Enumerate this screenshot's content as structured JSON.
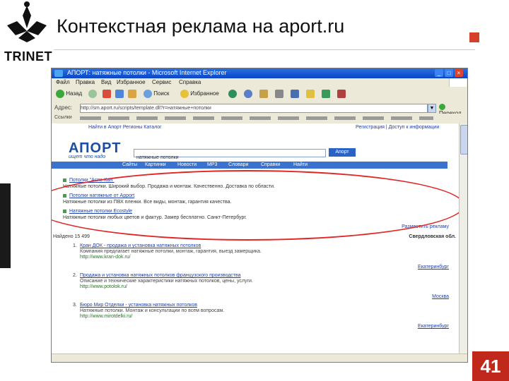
{
  "slide": {
    "title": "Контекстная реклама на aport.ru",
    "logo_text": "TRINET",
    "page_number": "41"
  },
  "browser": {
    "title": "АПОРТ: натяжные потолки - Microsoft Internet Explorer",
    "menu": [
      "Файл",
      "Правка",
      "Вид",
      "Избранное",
      "Сервис",
      "Справка"
    ],
    "toolbar": {
      "back": "Назад",
      "search": "Поиск",
      "favorites": "Избранное"
    },
    "address_label": "Адрес:",
    "address_value": "http://sm.aport.ru/scripts/template.dll?r=натяжные+потолки",
    "go_label": "Переход",
    "links": [
      "Ссылки"
    ],
    "status": ""
  },
  "aport": {
    "top_links": "Найти в Апорт   Регионы   Каталог",
    "right_links": "Регистрация | Доступ к информации",
    "logo": "АПОРТ",
    "slogan": "ищет что надо",
    "query": "натяжные потолки",
    "search_button": "Апорт",
    "tabs": [
      "Сайты",
      "Картинки",
      "Новости",
      "MP3",
      "Словари",
      "Справки",
      "Найти"
    ],
    "ads": [
      {
        "title": "Потолки \"Аспе-Кан\"",
        "text": "Натяжные потолки. Широкий выбор. Продажа и монтаж. Качественно. Доставка по области."
      },
      {
        "title": "Потолки натяжные от Apport",
        "text": "Натяжные потолки из ПВХ пленки. Все виды, монтаж, гарантия качества."
      },
      {
        "title": "Натяжные потолки Ecostyle",
        "text": "Натяжные потолки любых цветов и фактур. Замер бесплатно. Санкт-Петербург."
      }
    ],
    "ads_footer": "Разместить рекламу",
    "results_count": "Найдено 15 499",
    "results_region": "Свердловская обл.",
    "results": [
      {
        "n": "1.",
        "title": "Кран ДОК - продажа и установка натяжных потолков",
        "text": "Компания предлагает натяжные потолки, монтаж, гарантия, выезд замерщика.",
        "url": "http://www.kran-dok.ru/",
        "region": "Екатеринбург"
      },
      {
        "n": "2.",
        "title": "Продажа и установка натяжных потолков французского производства",
        "text": "Описание и технические характеристики натяжных потолков, цены, услуги.",
        "url": "http://www.potolok.ru/",
        "region": "Москва"
      },
      {
        "n": "3.",
        "title": "Бюро Мир Отделки - установка натяжных потолков",
        "text": "Натяжные потолки. Монтаж и консультации по всем вопросам.",
        "url": "http://www.mirotdelki.ru/",
        "region": "Екатеринбург"
      }
    ]
  }
}
